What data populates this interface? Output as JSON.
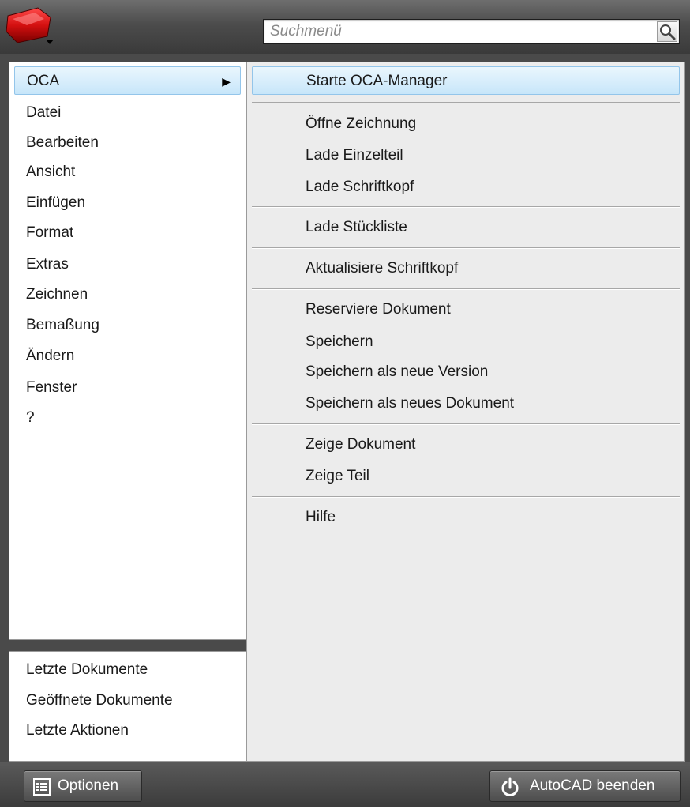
{
  "search": {
    "placeholder": "Suchmenü"
  },
  "icons": {
    "app_button": "autocad-app-icon",
    "search": "magnifier-icon",
    "options": "options-list-icon",
    "exit": "power-icon"
  },
  "main_menu": {
    "items": [
      {
        "label": "OCA",
        "active": true,
        "has_submenu": true
      },
      {
        "label": "Datei"
      },
      {
        "label": "Bearbeiten"
      },
      {
        "label": "Ansicht"
      },
      {
        "label": "Einfügen"
      },
      {
        "label": "Format"
      },
      {
        "label": "Extras"
      },
      {
        "label": "Zeichnen"
      },
      {
        "label": "Bemaßung"
      },
      {
        "label": "Ändern"
      },
      {
        "label": "Fenster"
      },
      {
        "label": "?"
      }
    ],
    "submenu_arrow": "▶"
  },
  "recent_menu": {
    "items": [
      {
        "label": "Letzte Dokumente"
      },
      {
        "label": "Geöffnete Dokumente"
      },
      {
        "label": "Letzte Aktionen"
      }
    ]
  },
  "oca_submenu": {
    "items": [
      {
        "label": "Starte OCA-Manager",
        "active": true
      },
      {
        "label": "Öffne Zeichnung"
      },
      {
        "label": "Lade Einzelteil"
      },
      {
        "label": "Lade Schriftkopf"
      },
      {
        "label": "Lade Stückliste"
      },
      {
        "label": "Aktualisiere Schriftkopf"
      },
      {
        "label": "Reserviere Dokument"
      },
      {
        "label": "Speichern"
      },
      {
        "label": "Speichern als neue Version"
      },
      {
        "label": "Speichern als neues Dokument"
      },
      {
        "label": "Zeige Dokument"
      },
      {
        "label": "Zeige Teil"
      },
      {
        "label": "Hilfe"
      }
    ]
  },
  "footer": {
    "options_label": "Optionen",
    "exit_label": "AutoCAD beenden"
  },
  "colors": {
    "highlight": "#c7e6fa",
    "frame": "#4a4a4a",
    "submenu_bg": "#ececec"
  }
}
